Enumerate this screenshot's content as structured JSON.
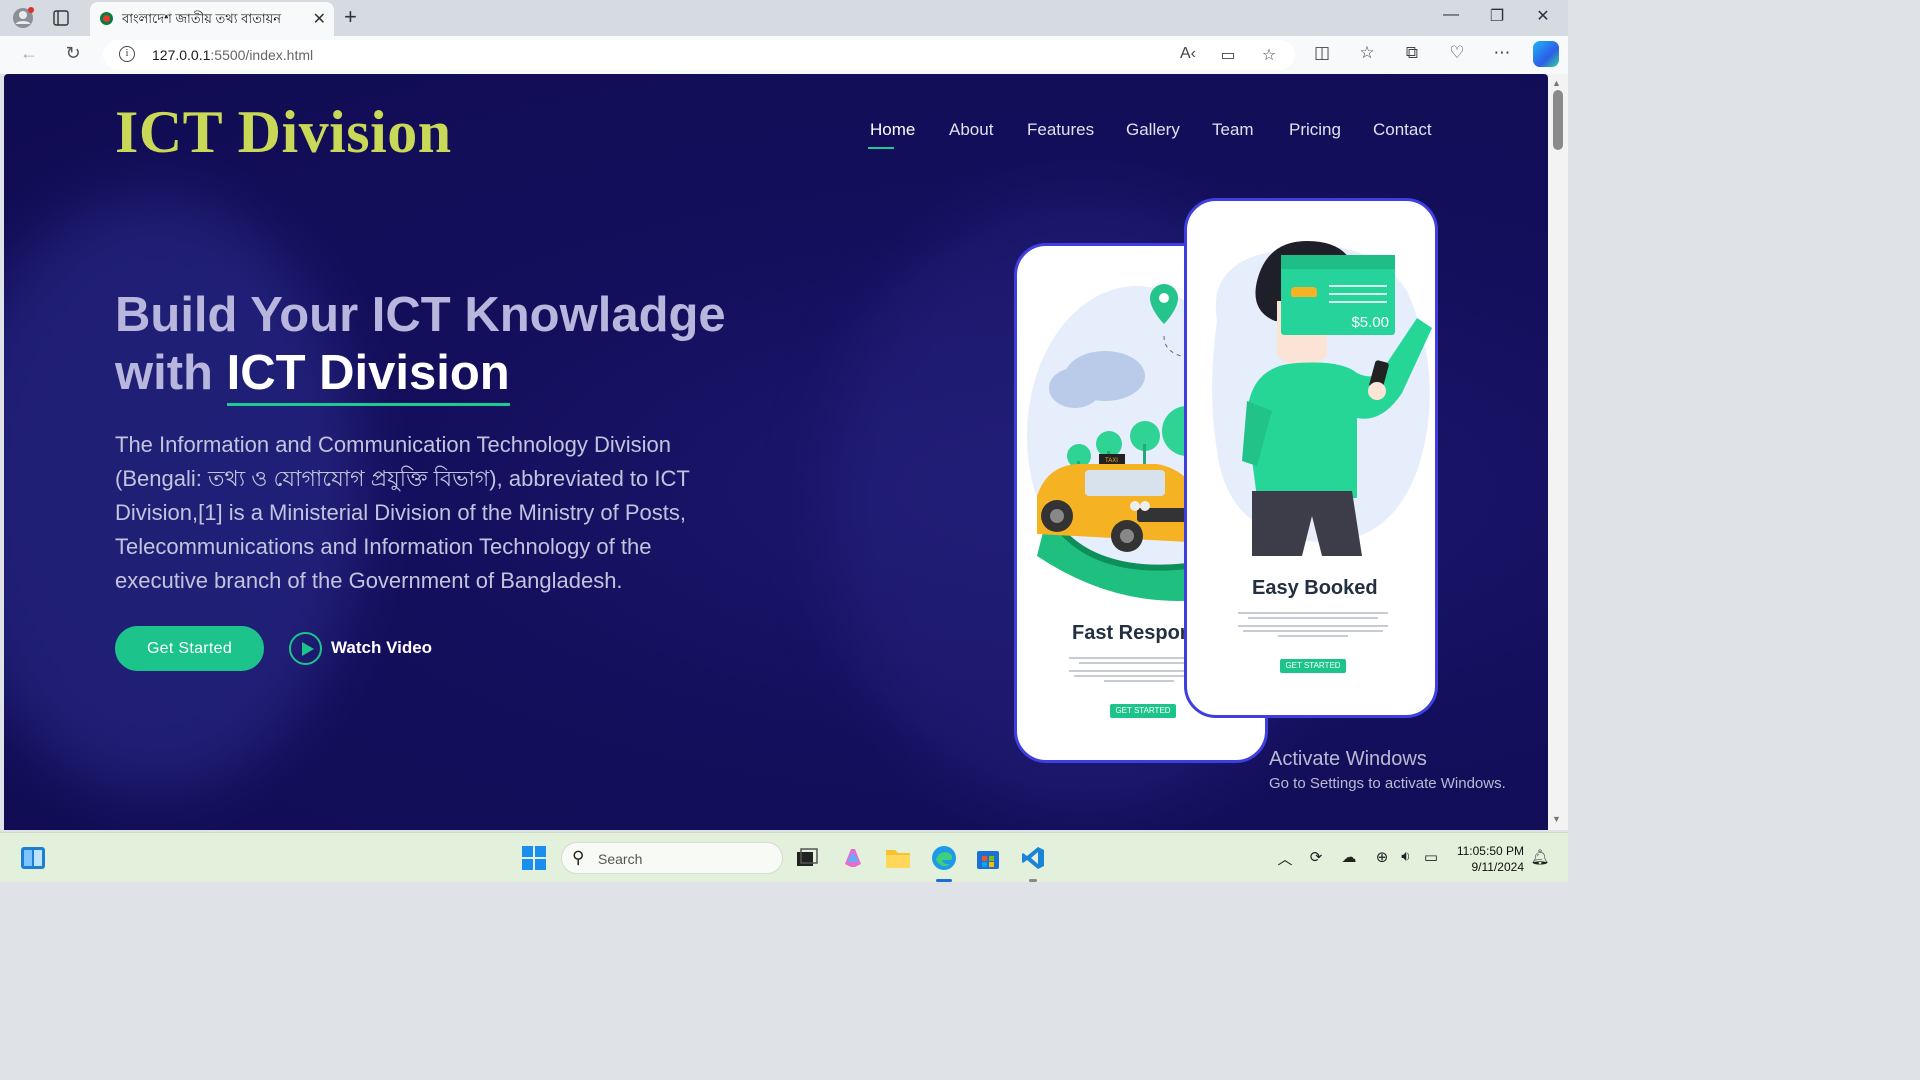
{
  "browser": {
    "tab_title": "বাংলাদেশ জাতীয় তথ্য বাতায়ন",
    "url_host": "127.0.0.1",
    "url_path": ":5500/index.html"
  },
  "site": {
    "logo": "ICT Division",
    "nav": [
      "Home",
      "About",
      "Features",
      "Gallery",
      "Team",
      "Pricing",
      "Contact"
    ],
    "active_nav": "Home"
  },
  "hero": {
    "title_line1": "Build Your ICT Knowladge",
    "title_prefix": "with ",
    "title_highlight": "ICT Division",
    "description": "The Information and Communication Technology Division (Bengali: তথ্য ও যোগাযোগ প্রযুক্তি বিভাগ), abbreviated to ICT Division,[1] is a Ministerial Division of the Ministry of Posts, Telecommunications and Information Technology of the executive branch of the Government of Bangladesh.",
    "cta_label": "Get Started",
    "video_label": "Watch Video"
  },
  "phones": {
    "left_title": "Fast Response",
    "left_button": "GET STARTED",
    "right_title": "Easy Booked",
    "right_button": "GET STARTED",
    "price": "$5.00",
    "taxi_sign": "TAXI"
  },
  "watermark": {
    "line1": "Activate Windows",
    "line2": "Go to Settings to activate Windows."
  },
  "taskbar": {
    "search_placeholder": "Search",
    "time": "11:05:50 PM",
    "date": "9/11/2024"
  },
  "colors": {
    "hero_bg": "#140f5c",
    "accent": "#1cc48b",
    "logo": "#c9d857",
    "phone_border": "#3f3fe0"
  }
}
